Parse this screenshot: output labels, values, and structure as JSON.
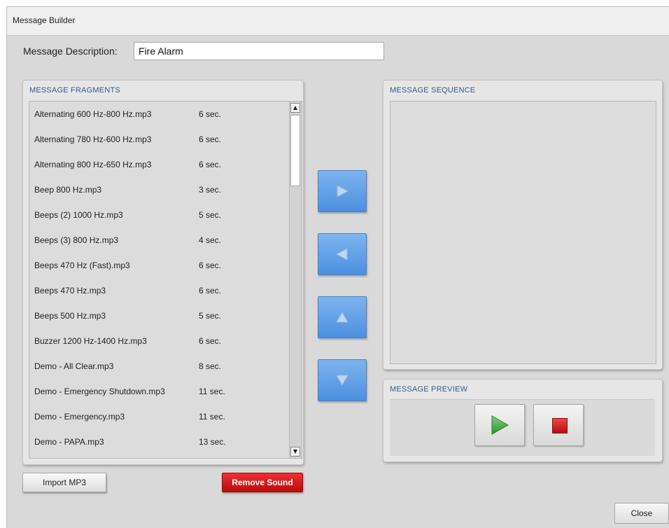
{
  "window": {
    "title": "Message Builder"
  },
  "description": {
    "label": "Message Description:",
    "value": "Fire Alarm"
  },
  "fragments": {
    "title": "MESSAGE FRAGMENTS",
    "items": [
      {
        "name": "Alternating 600 Hz-800 Hz.mp3",
        "duration": "6 sec."
      },
      {
        "name": "Alternating 780 Hz-600 Hz.mp3",
        "duration": "6 sec."
      },
      {
        "name": "Alternating 800 Hz-650 Hz.mp3",
        "duration": "6 sec."
      },
      {
        "name": "Beep 800 Hz.mp3",
        "duration": "3 sec."
      },
      {
        "name": "Beeps (2) 1000 Hz.mp3",
        "duration": "5 sec."
      },
      {
        "name": "Beeps (3) 800 Hz.mp3",
        "duration": "4 sec."
      },
      {
        "name": "Beeps 470 Hz (Fast).mp3",
        "duration": "6 sec."
      },
      {
        "name": "Beeps 470 Hz.mp3",
        "duration": "6 sec."
      },
      {
        "name": "Beeps 500 Hz.mp3",
        "duration": "5 sec."
      },
      {
        "name": "Buzzer 1200 Hz-1400 Hz.mp3",
        "duration": "6 sec."
      },
      {
        "name": "Demo - All Clear.mp3",
        "duration": "8 sec."
      },
      {
        "name": "Demo - Emergency Shutdown.mp3",
        "duration": "11 sec."
      },
      {
        "name": "Demo - Emergency.mp3",
        "duration": "11 sec."
      },
      {
        "name": "Demo - PAPA.mp3",
        "duration": "13 sec."
      }
    ]
  },
  "sequence": {
    "title": "MESSAGE SEQUENCE"
  },
  "preview": {
    "title": "MESSAGE PREVIEW"
  },
  "buttons": {
    "import": "Import MP3",
    "remove": "Remove Sound",
    "close": "Close"
  },
  "icons": {
    "add": "arrow-right-icon",
    "remove": "arrow-left-icon",
    "up": "arrow-up-icon",
    "down": "arrow-down-icon",
    "play": "play-icon",
    "stop": "stop-icon"
  },
  "colors": {
    "accent_blue": "#5b9be6",
    "danger_red": "#d11a1a",
    "play_green": "#3faa3f"
  }
}
